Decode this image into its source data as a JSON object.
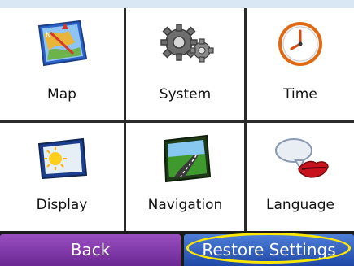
{
  "tiles": [
    {
      "label": "Map",
      "icon": "map-icon"
    },
    {
      "label": "System",
      "icon": "gears-icon"
    },
    {
      "label": "Time",
      "icon": "clock-icon"
    },
    {
      "label": "Display",
      "icon": "display-icon"
    },
    {
      "label": "Navigation",
      "icon": "road-icon"
    },
    {
      "label": "Language",
      "icon": "speech-lips-icon"
    }
  ],
  "buttons": {
    "back": "Back",
    "restore": "Restore Settings"
  },
  "colors": {
    "back": "#7b34a6",
    "restore": "#2a58c0",
    "highlight": "#ffe800"
  }
}
